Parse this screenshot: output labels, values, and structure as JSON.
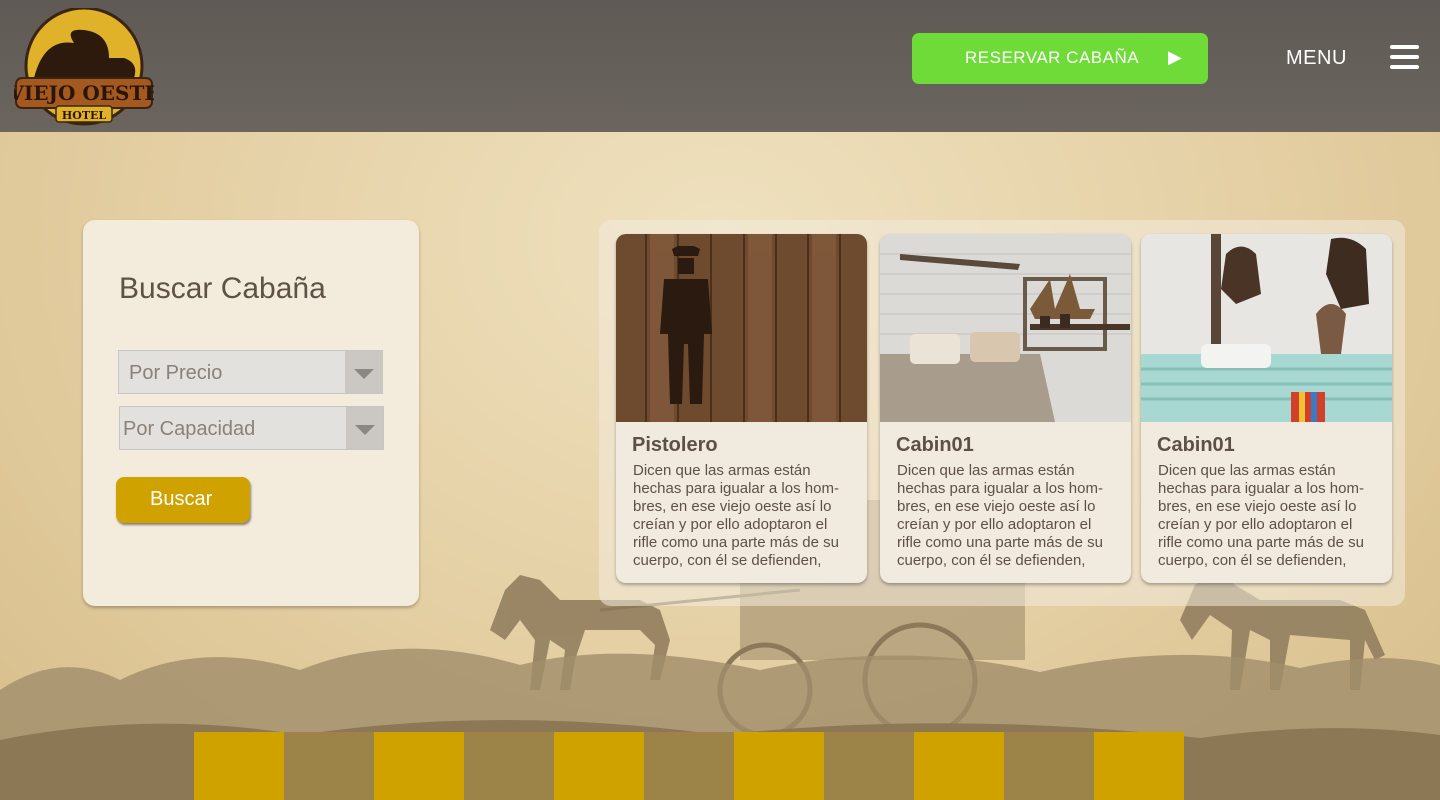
{
  "brand": {
    "logo_line1": "VIEJO OESTE",
    "logo_line2": "HOTEL"
  },
  "header": {
    "reserve_label": "RESERVAR CABAÑA",
    "reserve_arrow": "▶",
    "menu_label": "MENU"
  },
  "search": {
    "title": "Buscar Cabaña",
    "price_select": "Por Precio",
    "capacity_select": "Por Capacidad",
    "button": "Buscar"
  },
  "cards": [
    {
      "title": "Pistolero",
      "description": "Dicen que las armas están hechas para igualar a los hom-bres, en ese viejo oeste así lo creían y por ello adoptaron el rifle como una parte más de su cuerpo, con él se defienden,",
      "image": "gunslinger-on-wood"
    },
    {
      "title": "Cabin01",
      "description": "Dicen que las armas están hechas para igualar a los hom-bres, en ese viejo oeste así lo creían y por ello adoptaron el rifle como una parte más de su cuerpo, con él se defienden,",
      "image": "bedroom-ship-model"
    },
    {
      "title": "Cabin01",
      "description": "Dicen que las armas están hechas para igualar a los hom-bres, en ese viejo oeste así lo creían y por ello adoptaron el rifle como una parte más de su cuerpo, con él se defienden,",
      "image": "bedroom-saddles"
    }
  ],
  "colors": {
    "header_bg": "#645f59",
    "reserve_green": "#6fdb38",
    "gold": "#cfa200",
    "brown": "#9c8449",
    "panel": "#f3ebdc"
  }
}
